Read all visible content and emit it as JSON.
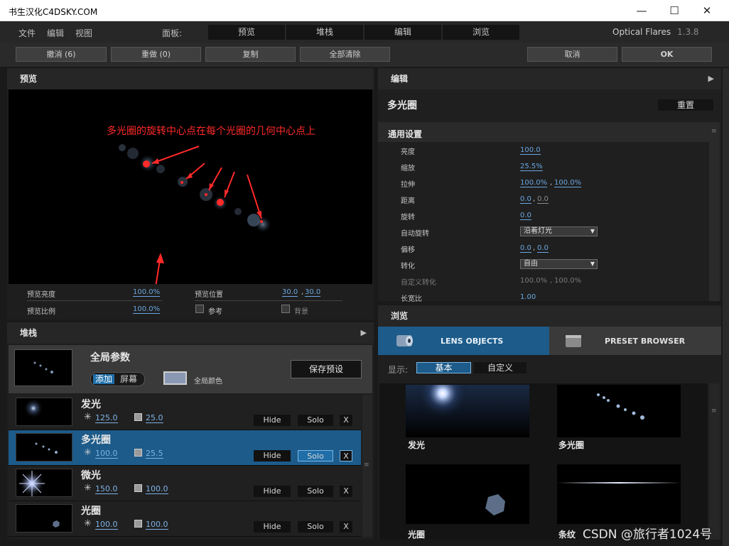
{
  "window": {
    "title": "书生汉化C4DSKY.COM",
    "minimize": "—",
    "maximize": "☐",
    "close": "✕"
  },
  "menu": {
    "file": "文件",
    "edit": "编辑",
    "view": "视图",
    "panel_label": "面板:"
  },
  "panel_tabs": [
    "预览",
    "堆栈",
    "编辑",
    "浏览"
  ],
  "app": {
    "name": "Optical Flares",
    "version": "1.3.8"
  },
  "toolbar": {
    "undo": "撤消 (6)",
    "redo": "重做 (0)",
    "copy": "复制",
    "clear_all": "全部清除",
    "cancel": "取消",
    "ok": "OK"
  },
  "preview": {
    "header": "预览",
    "annotation": "多光圈的旋转中心点在每个光圈的几何中心点上",
    "brightness_label": "预览亮度",
    "brightness_value": "100.0%",
    "position_label": "预览位置",
    "position_x": "30.0",
    "position_sep": ",",
    "position_y": "30.0",
    "scale_label": "预览比例",
    "scale_value": "100.0%",
    "ref_label": "参考",
    "bg_label": "背景"
  },
  "stack": {
    "header": "堆栈",
    "global": {
      "title": "全局参数",
      "add": "添加",
      "screen": "屏幕",
      "color_label": "全局颜色",
      "save_preset": "保存预设"
    },
    "layers": [
      {
        "name": "发光",
        "brightness": "125.0",
        "scale": "25.0",
        "hide": "Hide",
        "solo": "Solo",
        "remove": "X"
      },
      {
        "name": "多光圈",
        "brightness": "100.0",
        "scale": "25.5",
        "hide": "Hide",
        "solo": "Solo",
        "remove": "X"
      },
      {
        "name": "微光",
        "brightness": "150.0",
        "scale": "100.0",
        "hide": "Hide",
        "solo": "Solo",
        "remove": "X"
      },
      {
        "name": "光圈",
        "brightness": "100.0",
        "scale": "100.0",
        "hide": "Hide",
        "solo": "Solo",
        "remove": "X"
      }
    ]
  },
  "editor": {
    "header": "编辑",
    "object_name": "多光圈",
    "reset": "重置",
    "section": "通用设置",
    "params": [
      {
        "label": "亮度",
        "v1": "100.0"
      },
      {
        "label": "缩放",
        "v1": "25.5%"
      },
      {
        "label": "拉伸",
        "v1": "100.0%",
        "sep": ",",
        "v2": "100.0%"
      },
      {
        "label": "距离",
        "v1": "0.0",
        "sep": ",",
        "v2": "0.0"
      },
      {
        "label": "旋转",
        "v1": "0.0"
      },
      {
        "label": "自动旋转",
        "dropdown": "沿着灯光"
      },
      {
        "label": "偏移",
        "v1": "0.0",
        "sep": ",",
        "v2": "0.0"
      },
      {
        "label": "转化",
        "dropdown": "自由"
      },
      {
        "label": "自定义转化",
        "v1": "100.0%",
        "sep": ",",
        "v2": "100.0%"
      },
      {
        "label": "长宽比",
        "v1": "1.00"
      }
    ]
  },
  "browser": {
    "header": "浏览",
    "tab_lens": "LENS OBJECTS",
    "tab_preset": "PRESET BROWSER",
    "show_label": "显示:",
    "basic": "基本",
    "custom": "自定义",
    "items": [
      "发光",
      "多光圈",
      "光圈",
      "条纹"
    ]
  },
  "watermark": "CSDN @旅行者1024号",
  "colors": {
    "accent": "#1c5b8a",
    "annotation_red": "#ff2a2a",
    "value_blue": "#6aa6e0"
  }
}
